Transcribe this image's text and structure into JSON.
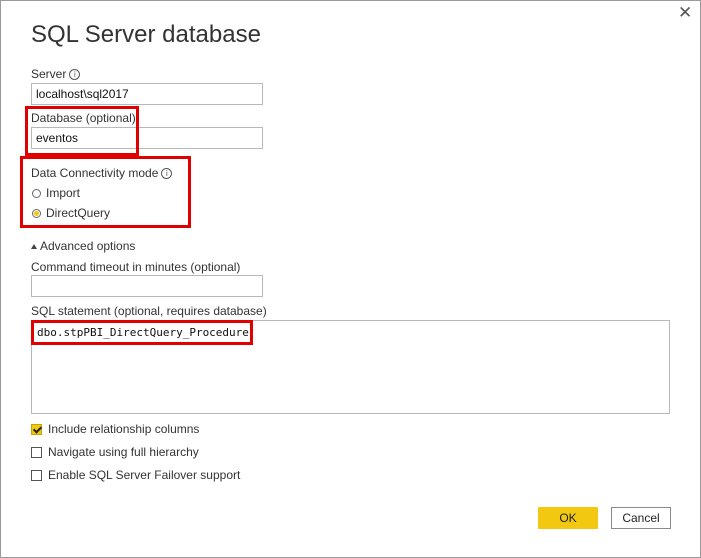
{
  "dialog": {
    "title": "SQL Server database",
    "close_glyph": "✕"
  },
  "server": {
    "label": "Server",
    "value": "localhost\\sql2017"
  },
  "database": {
    "label": "Database (optional)",
    "value": "eventos"
  },
  "connectivity": {
    "label": "Data Connectivity mode",
    "options": [
      {
        "label": "Import",
        "selected": false
      },
      {
        "label": "DirectQuery",
        "selected": true
      }
    ]
  },
  "advanced": {
    "toggle_label": "Advanced options",
    "timeout_label": "Command timeout in minutes (optional)",
    "timeout_value": "",
    "sql_label": "SQL statement (optional, requires database)",
    "sql_value": "dbo.stpPBI_DirectQuery_Procedure"
  },
  "checkboxes": [
    {
      "label": "Include relationship columns",
      "checked": true
    },
    {
      "label": "Navigate using full hierarchy",
      "checked": false
    },
    {
      "label": "Enable SQL Server Failover support",
      "checked": false
    }
  ],
  "buttons": {
    "ok": "OK",
    "cancel": "Cancel"
  },
  "colors": {
    "accent": "#f2c811",
    "highlight": "#e00000"
  },
  "icons": [
    "info-icon",
    "close-icon",
    "collapse-triangle-icon",
    "radio-icon",
    "checkbox-icon"
  ]
}
